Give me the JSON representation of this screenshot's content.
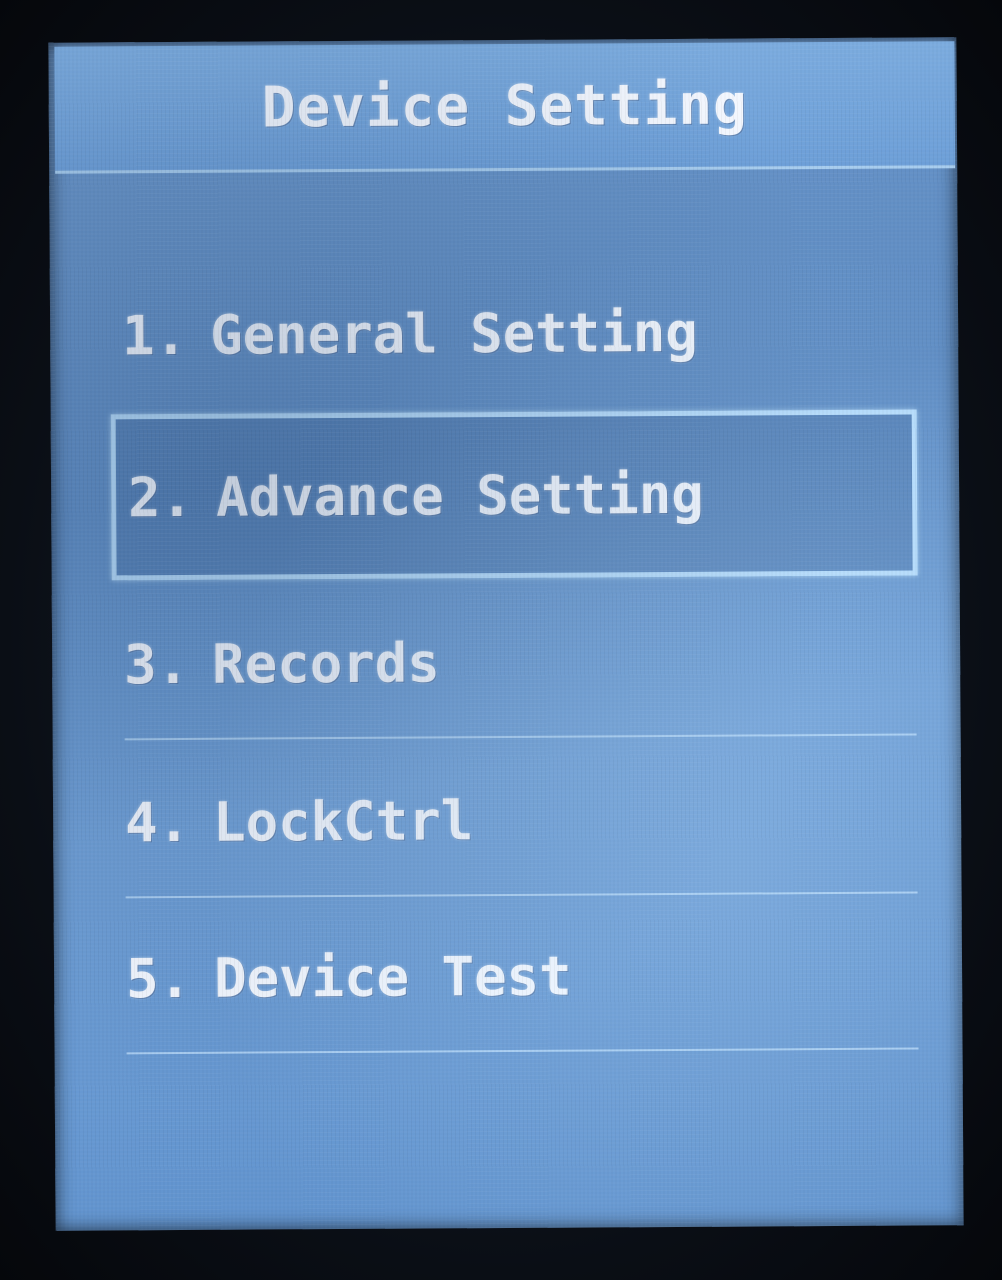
{
  "header": {
    "title": "Device Setting"
  },
  "menu": {
    "selected_index": 1,
    "items": [
      {
        "number": "1.",
        "label": "General Setting"
      },
      {
        "number": "2.",
        "label": "Advance Setting"
      },
      {
        "number": "3.",
        "label": "Records"
      },
      {
        "number": "4.",
        "label": "LockCtrl"
      },
      {
        "number": "5.",
        "label": "Device Test"
      }
    ]
  },
  "colors": {
    "screen_background": "#6a95c8",
    "title_bar": "#7cacdf",
    "text": "#f4f8ff",
    "selection_border": "#b6dcfb"
  }
}
